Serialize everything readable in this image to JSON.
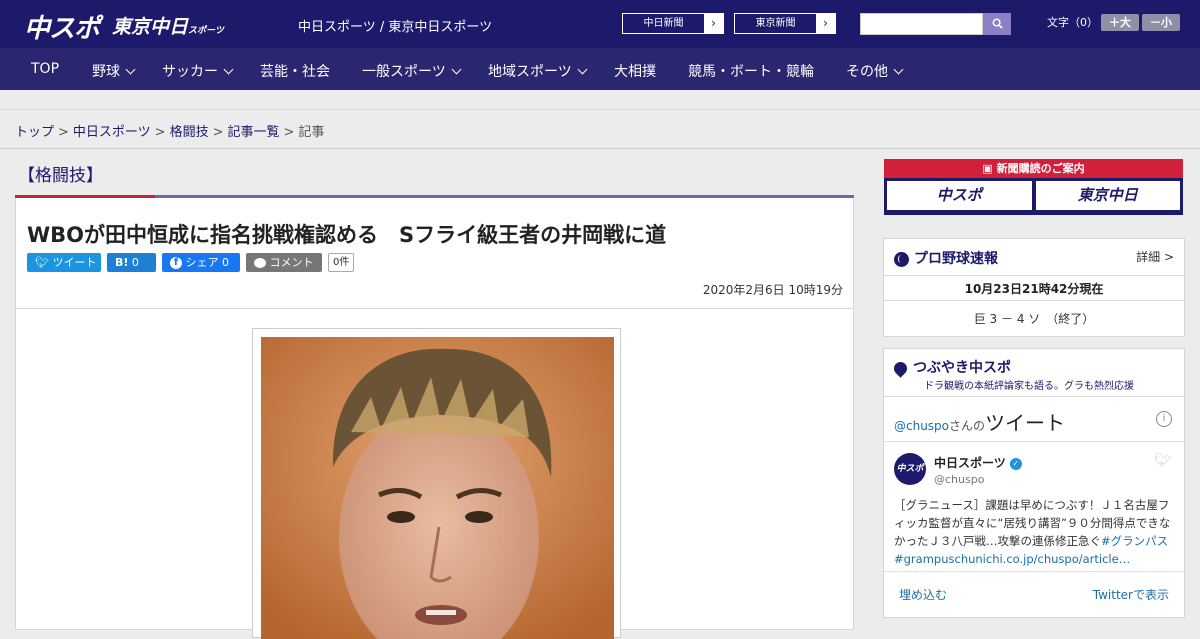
{
  "header": {
    "logo_main": "中スポ",
    "logo_tokyo": "東京中日",
    "logo_tokyo_small": "スポーツ",
    "site_title": "中日スポーツ / 東京中日スポーツ",
    "paper_links": [
      {
        "label": "中日新聞"
      },
      {
        "label": "東京新聞"
      }
    ],
    "search": {
      "placeholder": ""
    },
    "font_size_label": "文字（0）",
    "font_bigger": "＋大",
    "font_smaller": "－小"
  },
  "nav": {
    "items": [
      {
        "label": "TOP",
        "dropdown": false
      },
      {
        "label": "野球",
        "dropdown": true
      },
      {
        "label": "サッカー",
        "dropdown": true
      },
      {
        "label": "芸能・社会",
        "dropdown": false
      },
      {
        "label": "一般スポーツ",
        "dropdown": true
      },
      {
        "label": "地域スポーツ",
        "dropdown": true
      },
      {
        "label": "大相撲",
        "dropdown": false
      },
      {
        "label": "競馬・ボート・競輪",
        "dropdown": false
      },
      {
        "label": "その他",
        "dropdown": true
      }
    ]
  },
  "breadcrumb": {
    "items": [
      "トップ",
      "中日スポーツ",
      "格闘技",
      "記事一覧"
    ],
    "current": "記事"
  },
  "article": {
    "category": "【格闘技】",
    "headline": "WBOが田中恒成に指名挑戦権認める　Sフライ級王者の井岡戦に道",
    "share": {
      "tweet_label": "ツイート",
      "hatena_label": "B!",
      "hatena_count": "0",
      "facebook_label": "シェア",
      "facebook_count": "0",
      "comment_label": "コメント",
      "comment_count": "0件"
    },
    "date": "2020年2月6日 10時19分"
  },
  "sidebar": {
    "subscribe": {
      "heading": "新聞購読のご案内",
      "logo1": "中スポ",
      "logo2": "東京中日"
    },
    "baseball": {
      "title": "プロ野球速報",
      "detail_link": "詳細 >",
      "timestamp": "10月23日21時42分現在",
      "score_line": "巨 3 － 4 ソ　（終了）"
    },
    "tweets": {
      "title": "つぶやき中スポ",
      "subtitle": "ドラ観戦の本紙評論家も語る。グラも熱烈応援",
      "handle_prefix": "@chuspo",
      "handle_suffix": "さんの",
      "tweet_heading": "ツイート",
      "account_name": "中日スポーツ",
      "account_handle": "@chuspo",
      "avatar_text": "中スポ",
      "tweet_text": "［グラニュース］課題は早めにつぶす！Ｊ１名古屋フィッカ監督が直々に“居残り講習”９０分間得点できなかったＪ３八戸戦…攻撃の連係修正急ぐ",
      "tweet_hashtag": "#グランパス",
      "tweet_link": "#grampuschunichi.co.jp/chuspo/article…",
      "embed_label": "埋め込む",
      "view_on_twitter": "Twitterで表示"
    }
  },
  "colors": {
    "brand_navy": "#1d1a6b",
    "nav_bg": "#2a2670",
    "accent_red": "#d0203a",
    "twitter_blue": "#1b95e0"
  }
}
